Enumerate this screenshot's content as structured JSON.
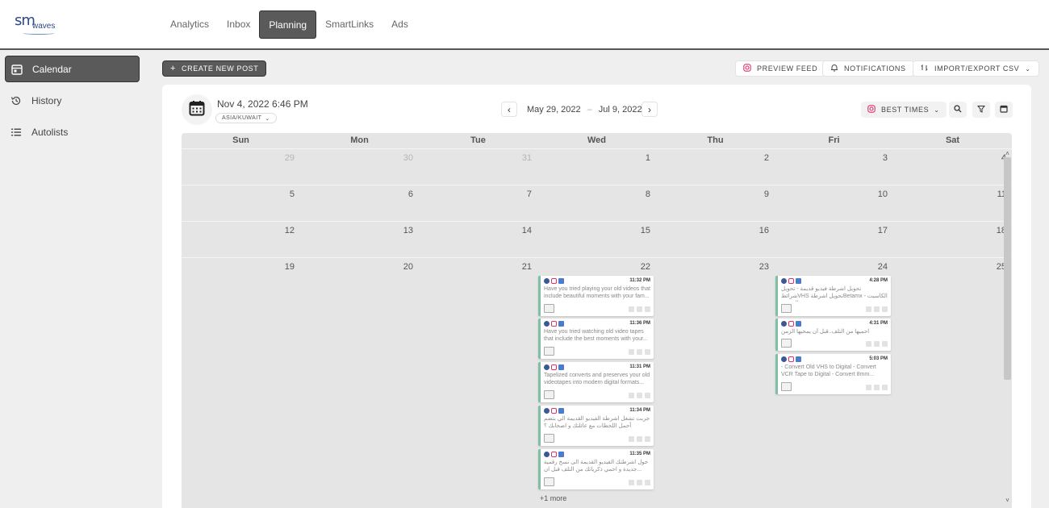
{
  "app": {
    "logo_text": "sm",
    "logo_sub": "waves"
  },
  "nav": {
    "items": [
      "Analytics",
      "Inbox",
      "Planning",
      "SmartLinks",
      "Ads"
    ],
    "active": "Planning"
  },
  "sidebar": {
    "items": [
      {
        "label": "Calendar",
        "icon": "calendar-icon"
      },
      {
        "label": "History",
        "icon": "history-icon"
      },
      {
        "label": "Autolists",
        "icon": "list-icon"
      }
    ]
  },
  "actions": {
    "create": "CREATE NEW POST",
    "preview": "PREVIEW FEED",
    "notifications": "NOTIFICATIONS",
    "import_export": "IMPORT/EXPORT CSV"
  },
  "calendar": {
    "datetime": "Nov 4, 2022 6:46 PM",
    "timezone": "ASIA/KUWAIT",
    "range_start": "May 29, 2022",
    "range_end": "Jul 9, 2022",
    "range_sep": "–",
    "best_times": "BEST TIMES",
    "days": [
      "Sun",
      "Mon",
      "Tue",
      "Wed",
      "Thu",
      "Fri",
      "Sat"
    ],
    "weeks": [
      [
        "29",
        "30",
        "31",
        "1",
        "2",
        "3",
        "4"
      ],
      [
        "5",
        "6",
        "7",
        "8",
        "9",
        "10",
        "11"
      ],
      [
        "12",
        "13",
        "14",
        "15",
        "16",
        "17",
        "18"
      ],
      [
        "19",
        "20",
        "21",
        "22",
        "23",
        "24",
        "25"
      ]
    ],
    "muted_cells": [
      "0-0",
      "0-1",
      "0-2"
    ],
    "posts_wed": [
      {
        "time": "11:32 PM",
        "text": "Have you tried playing your old videos that include beautiful moments with your fam..."
      },
      {
        "time": "11:36 PM",
        "text": "Have you tried watching old video tapes that include the best moments with your..."
      },
      {
        "time": "11:31 PM",
        "text": "Tapelized converts and preserves your old videotapes into modern digital formats..."
      },
      {
        "time": "11:34 PM",
        "text": "جربت تشغل اشرطة الفيديو القديمة الي بتضم أجمل اللحظات مع عائلتك و اصحابك ؟"
      },
      {
        "time": "11:35 PM",
        "text": "حول اشرطتك الفيديو القديمة الى نسخ رقمية جديدة و احمي ذكرياتك من التلف قبل ان..."
      }
    ],
    "posts_fri": [
      {
        "time": "4:28 PM",
        "text": "تحويل اشرطة فيديو قديمة - تحويل شرائطVHS تحويل اشرطةBetamx - الكاسيت الصوتية..."
      },
      {
        "time": "4:31 PM",
        "text": "احميها من التلف..قبل أن يمحيها الزمن"
      },
      {
        "time": "5:03 PM",
        "text": "- Convert Old VHS to Digital - Convert VCR Tape to Digital - Convert 8mm..."
      }
    ],
    "more_wed": "+1 more"
  },
  "colors": {
    "accent_dark": "#5a5a5a",
    "post_border": "#7fbfa4",
    "facebook": "#3b5998",
    "instagram": "#e1306c",
    "google": "#4a7bd0"
  }
}
